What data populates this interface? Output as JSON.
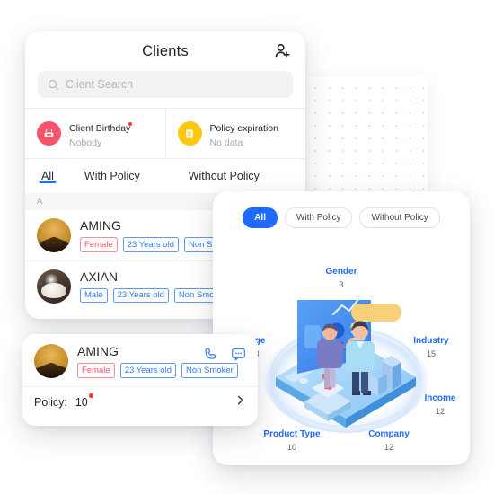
{
  "clients_card": {
    "header": {
      "title": "Clients",
      "add_icon": "add-person-icon"
    },
    "search": {
      "placeholder": "Client Search",
      "icon": "search-icon"
    },
    "stats": [
      {
        "icon": "birthday-cake-icon",
        "title": "Client Birthday",
        "value": "Nobody",
        "color": "#f8536b",
        "has_badge": true
      },
      {
        "icon": "document-icon",
        "title": "Policy expiration",
        "value": "No data",
        "color": "#fdc70b",
        "has_badge": false
      }
    ],
    "tabs": [
      {
        "label": "All",
        "active": true
      },
      {
        "label": "With Policy",
        "active": false
      },
      {
        "label": "Without Policy",
        "active": false
      }
    ],
    "section_letter": "A",
    "rows": [
      {
        "avatar": "avatar-aming",
        "name": "AMING",
        "tags": [
          {
            "text": "Female",
            "color": "#f4576c"
          },
          {
            "text": "23 Years old",
            "color": "#2f7cf6"
          },
          {
            "text": "Non Smoker",
            "color": "#2f7cf6"
          }
        ]
      },
      {
        "avatar": "avatar-axian",
        "name": "AXIAN",
        "tags": [
          {
            "text": "Male",
            "color": "#2f7cf6"
          },
          {
            "text": "23 Years old",
            "color": "#2f7cf6"
          },
          {
            "text": "Non Smoker",
            "color": "#2f7cf6"
          }
        ]
      }
    ]
  },
  "detail_card": {
    "avatar": "avatar-aming",
    "name": "AMING",
    "tags": [
      {
        "text": "Female",
        "color": "#f4576c"
      },
      {
        "text": "23 Years old",
        "color": "#2f7cf6"
      },
      {
        "text": "Non Smoker",
        "color": "#2f7cf6"
      }
    ],
    "actions": [
      {
        "icon": "phone-icon",
        "color": "#3b82f6"
      },
      {
        "icon": "message-icon",
        "color": "#3b82f6"
      }
    ],
    "policy_label": "Policy:",
    "policy_value": "10",
    "policy_has_badge": true,
    "chevron": "chevron-right-icon"
  },
  "analytics_card": {
    "tabs": [
      {
        "label": "All",
        "active": true
      },
      {
        "label": "With Policy",
        "active": false
      },
      {
        "label": "Without Policy",
        "active": false
      }
    ],
    "illustration": "isometric-data-analytics-illustration",
    "accent_color": "#1f6bff"
  },
  "chart_data": {
    "type": "bar",
    "title": "",
    "categories": [
      "Gender",
      "Age",
      "Industry",
      "Income",
      "Company",
      "Product Type"
    ],
    "values": [
      3,
      8,
      15,
      12,
      12,
      10
    ],
    "xlabel": "",
    "ylabel": "",
    "legend": [
      "All",
      "With Policy",
      "Without Policy"
    ],
    "annotations": [
      {
        "label": "Gender",
        "value": 3,
        "position": "top"
      },
      {
        "label": "Age",
        "value": 8,
        "position": "left"
      },
      {
        "label": "Industry",
        "value": 15,
        "position": "right"
      },
      {
        "label": "Income",
        "value": 12,
        "position": "right-lower"
      },
      {
        "label": "Company",
        "value": 12,
        "position": "bottom-right"
      },
      {
        "label": "Product Type",
        "value": 10,
        "position": "bottom-left"
      }
    ]
  }
}
